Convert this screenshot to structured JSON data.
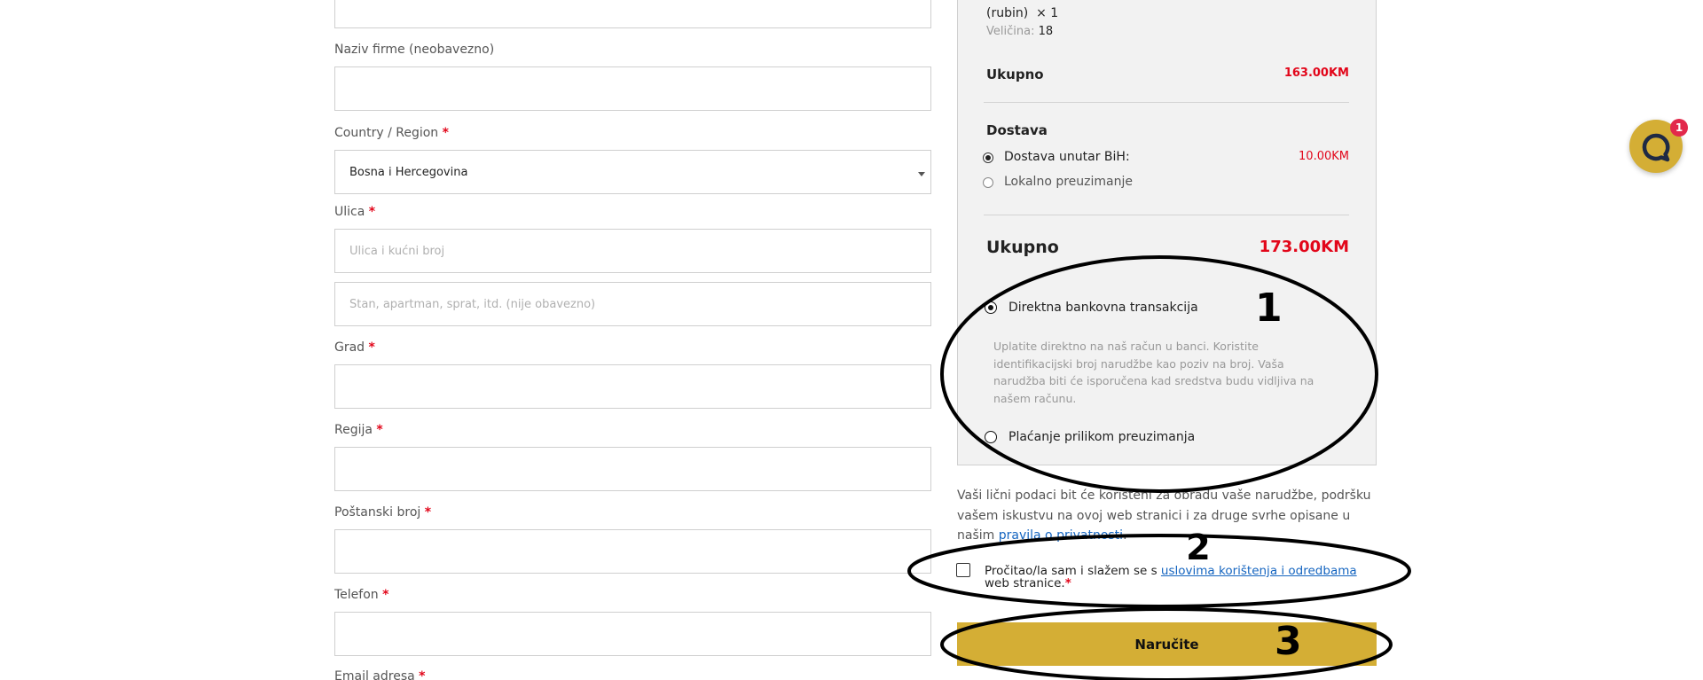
{
  "form": {
    "company_label": "Naziv firme (neobavezno)",
    "country_label": "Country / Region",
    "country_value": "Bosna i Hercegovina",
    "street_label": "Ulica",
    "street_placeholder": "Ulica i kućni broj",
    "apartment_placeholder": "Stan, apartman, sprat, itd. (nije obavezno)",
    "city_label": "Grad",
    "region_label": "Regija",
    "postal_label": "Poštanski broj",
    "phone_label": "Telefon",
    "email_label": "Email adresa",
    "required_mark": "*"
  },
  "order": {
    "item_variant": "(rubin)",
    "item_qty": "× 1",
    "size_label": "Veličina:",
    "size_value": "18",
    "subtotal_label": "Ukupno",
    "subtotal_value": "163.00KM",
    "shipping_label": "Dostava",
    "shipping_option1": "Dostava unutar BiH:",
    "shipping_option1_price": "10.00KM",
    "shipping_option2": "Lokalno preuzimanje",
    "total_label": "Ukupno",
    "total_value": "173.00KM"
  },
  "payment": {
    "option1_label": "Direktna bankovna transakcija",
    "option1_desc": "Uplatite direktno na naš račun u banci. Koristite identifikacijski broj narudžbe kao poziv na broj. Vaša narudžba biti će isporučena kad sredstva budu vidljiva na našem računu.",
    "option2_label": "Plaćanje prilikom preuzimanja"
  },
  "privacy": {
    "text": "Vaši lični podaci bit će korišteni za obradu vaše narudžbe, podršku vašem iskustvu na ovoj web stranici i za druge svrhe opisane u našim",
    "link": "pravila o privatnosti",
    "end": "."
  },
  "terms": {
    "text_before": "Pročitao/la sam i slažem se s",
    "link": "uslovima korištenja i odredbama",
    "text_after": "web stranice."
  },
  "button": {
    "order_label": "Naručite"
  },
  "chat": {
    "badge_count": "1"
  },
  "annotations": {
    "n1": "1",
    "n2": "2",
    "n3": "3"
  },
  "colors": {
    "accent": "#d4ae35",
    "price_red": "#e2061a",
    "link_blue": "#1565c0",
    "badge": "#e2294b"
  }
}
